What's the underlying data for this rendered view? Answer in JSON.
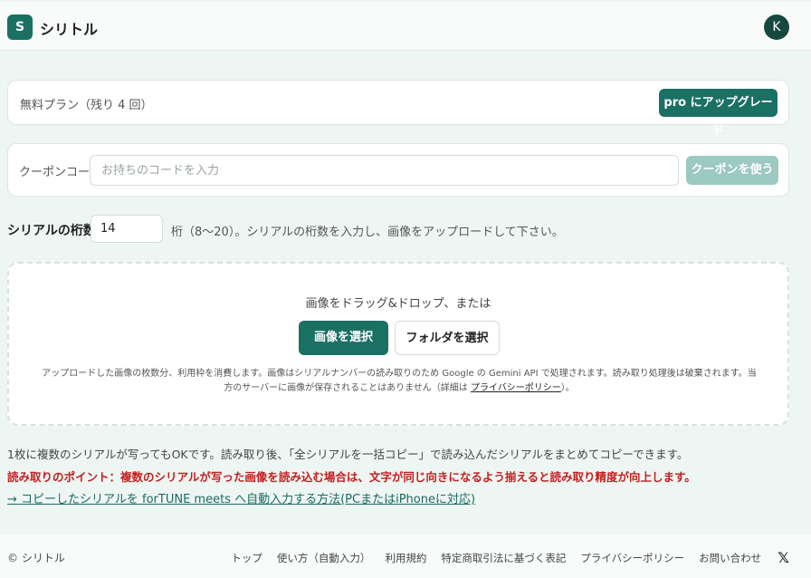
{
  "header": {
    "logo_letter": "S",
    "app_name": "シリトル",
    "avatar_initial": "K"
  },
  "plan": {
    "text": "無料プラン（残り 4 回）",
    "upgrade_label": "pro にアップグレード"
  },
  "coupon": {
    "label": "クーポンコード",
    "placeholder": "お持ちのコードを入力",
    "button_label": "クーポンを使う"
  },
  "digits": {
    "label": "シリアルの桁数",
    "value": "14",
    "hint": "桁（8〜20）。シリアルの桁数を入力し、画像をアップロードして下さい。"
  },
  "dropzone": {
    "text": "画像をドラッグ&ドロップ、または",
    "select_image_label": "画像を選択",
    "select_folder_label": "フォルダを選択",
    "note_before": "アップロードした画像の枚数分、利用枠を消費します。画像はシリアルナンバーの読み取りのため Google の Gemini API で処理されます。読み取り処理後は破棄されます。当方のサーバーに画像が保存されることはありません（詳細は ",
    "note_link": "プライバシーポリシー",
    "note_after": "）。"
  },
  "info": {
    "line1": "1枚に複数のシリアルが写ってもOKです。読み取り後、「全シリアルを一括コピー」で読み込んだシリアルをまとめてコピーできます。",
    "line2": "読み取りのポイント：複数のシリアルが写った画像を読み込む場合は、文字が同じ向きになるよう揃えると読み取り精度が向上します。",
    "link": "→ コピーしたシリアルを forTUNE meets へ自動入力する方法(PCまたはiPhoneに対応)"
  },
  "footer": {
    "copyright": "© シリトル",
    "links": [
      "トップ",
      "使い方（自動入力）",
      "利用規約",
      "特定商取引法に基づく表記",
      "プライバシーポリシー",
      "お問い合わせ"
    ],
    "x_icon": "x-logo-icon"
  },
  "colors": {
    "brand": "#1b7064",
    "warning_text": "#c41e1e",
    "background": "#eef6f3"
  }
}
